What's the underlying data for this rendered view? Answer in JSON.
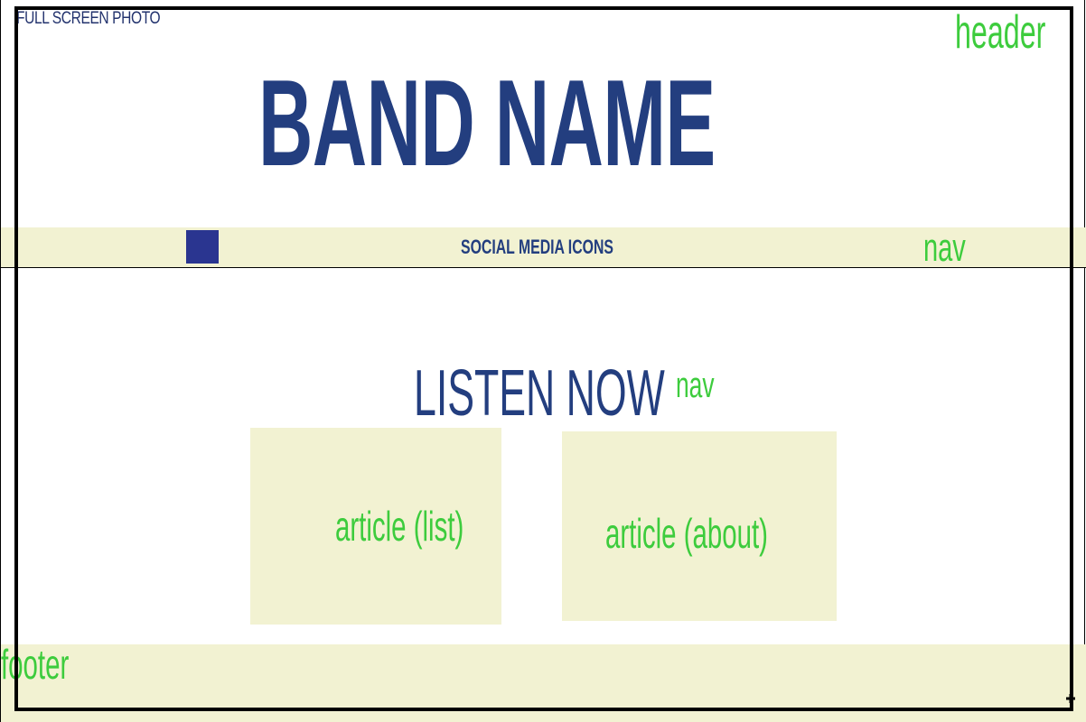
{
  "photo_label": "FULL SCREEN PHOTO",
  "band_name": "BAND NAME",
  "social_label": "SOCIAL MEDIA ICONS",
  "listen_now": "LISTEN NOW",
  "tags": {
    "header": "header",
    "nav_top": "nav",
    "nav_middle": "nav",
    "article_list": "article (list)",
    "article_about": "article (about)",
    "footer": "footer"
  },
  "colors": {
    "title_blue": "#233e7f",
    "icon_blue": "#2a3590",
    "annotation_green": "#3dcc3d",
    "panel_cream": "#f2f2d2",
    "frame_black": "#000000",
    "background": "#ffffff"
  },
  "icons": {
    "social_icon": "social-media-icon-placeholder",
    "resize": "resize-handle-icon"
  }
}
